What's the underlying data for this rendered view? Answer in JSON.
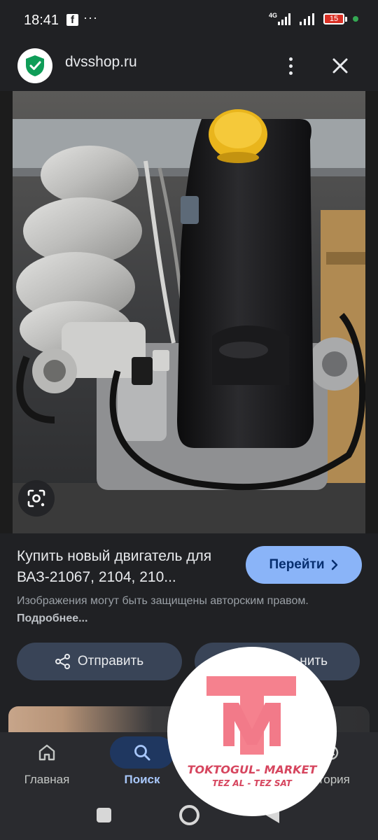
{
  "status_bar": {
    "time": "18:41",
    "notification_app": "f",
    "more_notifications": "···",
    "network": "4G",
    "battery": "15"
  },
  "header": {
    "site": "dvsshop.ru",
    "more_icon": "more-vert-icon",
    "close_icon": "close-icon"
  },
  "image": {
    "lens_icon": "google-lens-icon"
  },
  "result": {
    "title": "Купить новый двигатель для ВАЗ-21067, 2104, 210...",
    "visit_label": "Перейти",
    "copyright_text": "Изображения могут быть защищены авторским правом.",
    "more_link": "Подробнее..."
  },
  "actions": {
    "share_label": "Отправить",
    "save_label_visible": "нить"
  },
  "bottom_nav": {
    "items": [
      {
        "label": "Главная",
        "icon": "home-icon"
      },
      {
        "label": "Поиск",
        "icon": "search-icon"
      },
      {
        "label": "",
        "icon": "saved-icon"
      },
      {
        "label": "стория",
        "icon": "history-icon"
      }
    ]
  },
  "watermark": {
    "brand": "TOKTOGUL- MARKET",
    "slogan": "TEZ AL - TEZ SAT"
  },
  "colors": {
    "accent_button": "#8ab4f8",
    "chip_button": "#394457",
    "active_nav": "#1f3760",
    "watermark_pink": "#f5818e"
  }
}
